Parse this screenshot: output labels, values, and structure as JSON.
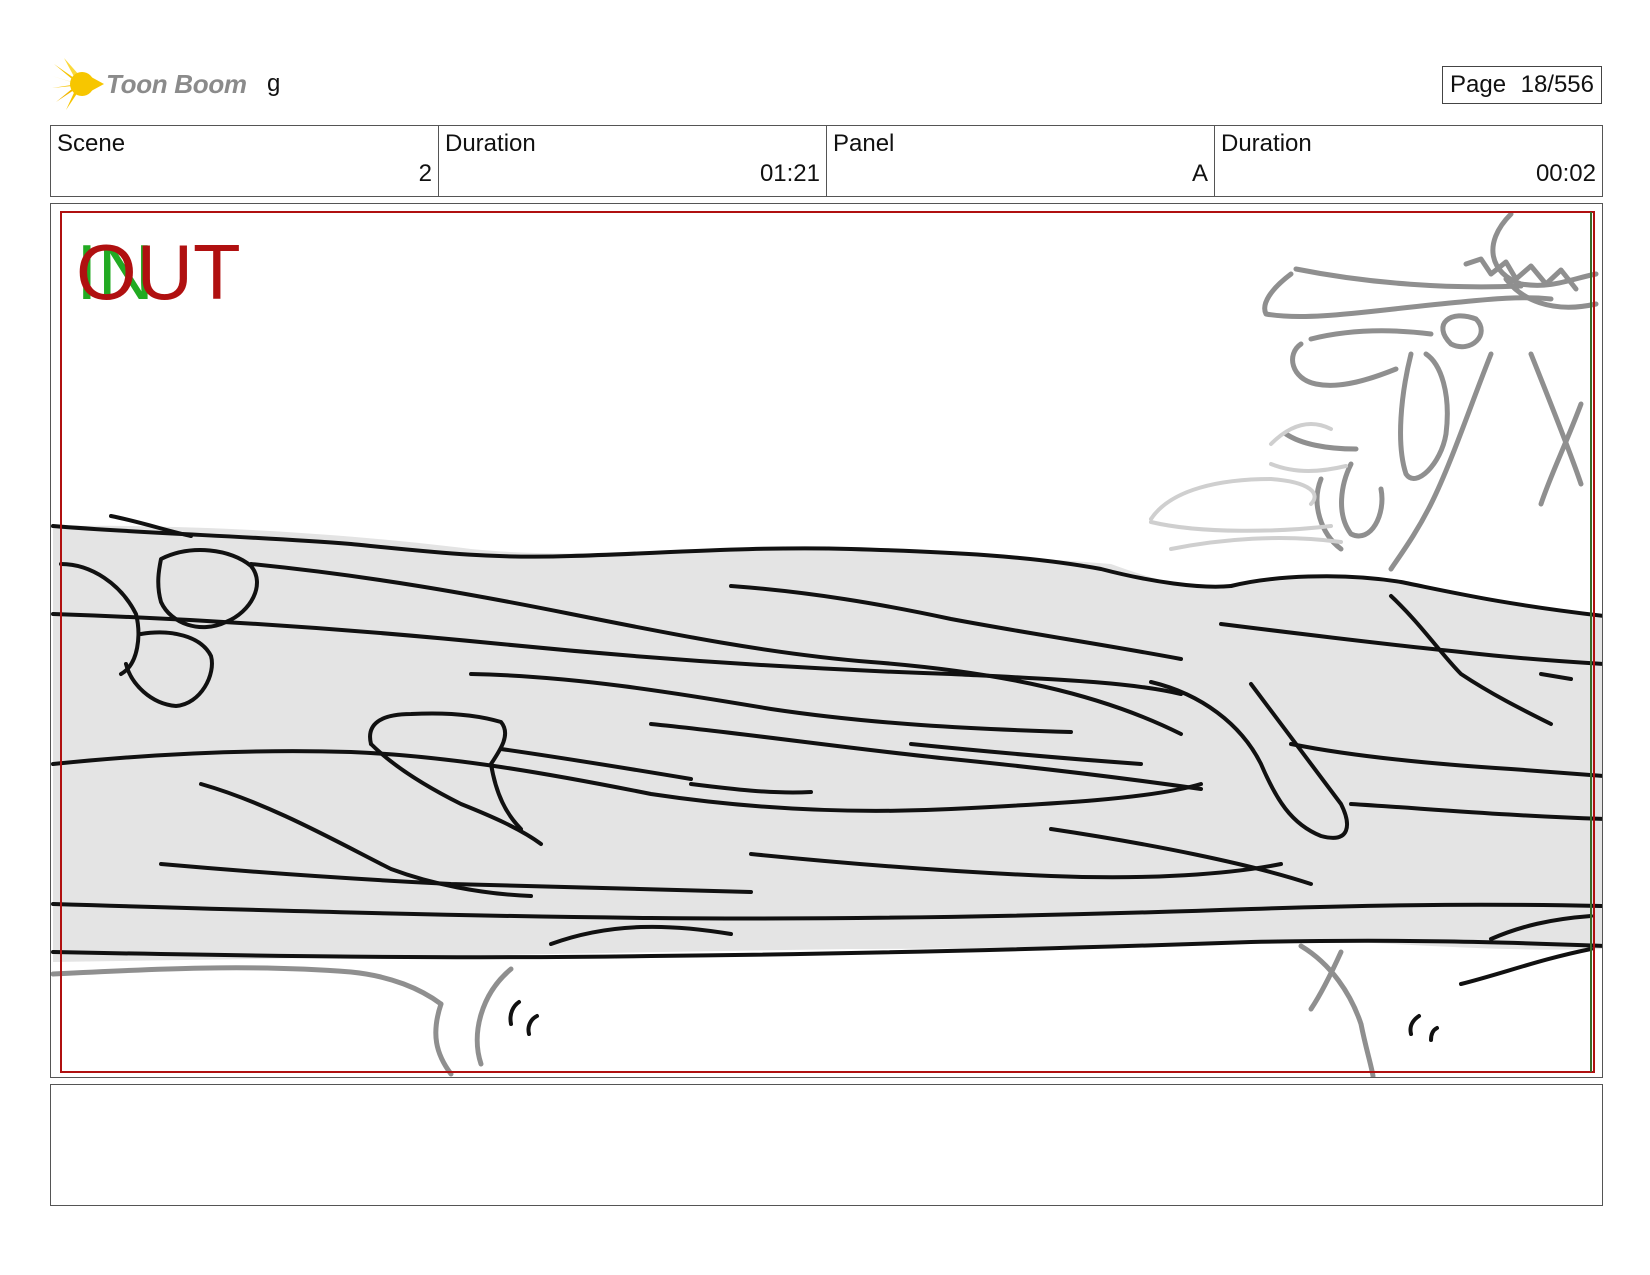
{
  "header": {
    "brand": "Toon Boom",
    "brand_icon": "starburst-logo-icon",
    "project_name": "g",
    "page_label": "Page",
    "page_value": "18/556"
  },
  "info": {
    "scene_label": "Scene",
    "scene_value": "2",
    "scene_duration_label": "Duration",
    "scene_duration_value": "01:21",
    "panel_label": "Panel",
    "panel_value": "A",
    "panel_duration_label": "Duration",
    "panel_duration_value": "00:02"
  },
  "panel": {
    "in_marker": "IN",
    "out_marker": "OUT",
    "in_color": "#22aa22",
    "out_color": "#b01010",
    "frame_color": "#b01010"
  },
  "notes": {
    "text": ""
  }
}
